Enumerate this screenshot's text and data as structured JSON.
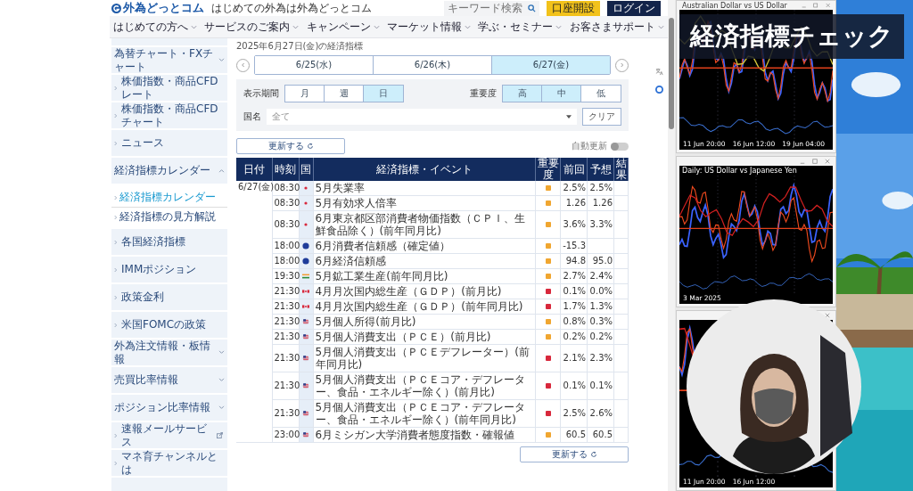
{
  "header": {
    "logo": "外為どっとコム",
    "tagline": "はじめての外為は外為どっとコム",
    "search": {
      "placeholder": "キーワード検索"
    },
    "buttons": [
      {
        "label": "口座開設",
        "kind": "primary"
      },
      {
        "label": "ログイン",
        "kind": "dark"
      }
    ]
  },
  "nav": [
    "はじめての方へ",
    "サービスのご案内",
    "キャンペーン",
    "マーケット情報",
    "学ぶ・セミナー",
    "お客さまサポート"
  ],
  "sidebar": [
    {
      "label": "為替チャート・FXチャート",
      "kind": "group",
      "expanded": false
    },
    {
      "label": "株価指数・商品CFDレート",
      "kind": "link"
    },
    {
      "label": "株価指数・商品CFDチャート",
      "kind": "link"
    },
    {
      "label": "ニュース",
      "kind": "link"
    },
    {
      "label": "経済指標カレンダー",
      "kind": "group",
      "expanded": true,
      "children": [
        {
          "label": "経済指標カレンダー",
          "selected": true
        },
        {
          "label": "経済指標の見方解説",
          "selected": false
        }
      ]
    },
    {
      "label": "各国経済指標",
      "kind": "link"
    },
    {
      "label": "IMMポジション",
      "kind": "link"
    },
    {
      "label": "政策金利",
      "kind": "link"
    },
    {
      "label": "米国FOMCの政策",
      "kind": "link"
    },
    {
      "label": "外為注文情報・板情報",
      "kind": "group",
      "expanded": false
    },
    {
      "label": "売買比率情報",
      "kind": "group",
      "expanded": false
    },
    {
      "label": "ポジション比率情報",
      "kind": "group",
      "expanded": false
    },
    {
      "label": "速報メールサービス",
      "kind": "link",
      "external": true
    },
    {
      "label": "マネ育チャンネルとは",
      "kind": "link"
    }
  ],
  "page_title": "2025年6月27日(金)の経済指標",
  "date_tabs": [
    {
      "label": "6/25(水)",
      "selected": false
    },
    {
      "label": "6/26(木)",
      "selected": false
    },
    {
      "label": "6/27(金)",
      "selected": true
    }
  ],
  "filters": {
    "period": {
      "label": "表示期間",
      "options": [
        {
          "label": "月",
          "selected": false
        },
        {
          "label": "週",
          "selected": false
        },
        {
          "label": "日",
          "selected": true
        }
      ]
    },
    "importance": {
      "label": "重要度",
      "options": [
        {
          "label": "高",
          "selected": true
        },
        {
          "label": "中",
          "selected": true
        },
        {
          "label": "低",
          "selected": false
        }
      ]
    },
    "country": {
      "label": "国名",
      "value": "全て"
    },
    "clear": "クリア"
  },
  "refresh_top": "更新する",
  "refresh_bottom": "更新する",
  "auto_update": {
    "label": "自動更新",
    "on": false
  },
  "table": {
    "columns": [
      "日付",
      "時刻",
      "国",
      "経済指標・イベント",
      "重要度",
      "前回",
      "予想",
      "結果"
    ],
    "date": "6/27(金)",
    "rows": [
      {
        "time": "08:30",
        "kind": "japan",
        "event": "5月失業率",
        "color": "#f0a630",
        "previous": "2.5%",
        "forecast": "2.5%"
      },
      {
        "time": "08:30",
        "kind": "japan",
        "event": "5月有効求人倍率",
        "color": "#f0a630",
        "previous": "1.26",
        "forecast": "1.26"
      },
      {
        "time": "08:30",
        "kind": "japan",
        "event": "6月東京都区部消費者物価指数（ＣＰＩ、生鮮食品除く）(前年同月比)",
        "color": "#f0a630",
        "previous": "3.6%",
        "forecast": "3.3%"
      },
      {
        "time": "18:00",
        "kind": "eu",
        "event": "6月消費者信頼感（確定値）",
        "color": "#f0a630",
        "previous": "-15.3"
      },
      {
        "time": "18:00",
        "kind": "eu",
        "event": "6月経済信頼感",
        "color": "#f0a630",
        "previous": "94.8",
        "forecast": "95.0"
      },
      {
        "time": "19:30",
        "kind": "india",
        "event": "5月鉱工業生産(前年同月比)",
        "color": "#f0a630",
        "previous": "2.7%",
        "forecast": "2.4%"
      },
      {
        "time": "21:30",
        "kind": "canada",
        "event": "4月月次国内総生産（ＧＤＰ）(前月比)",
        "color": "#d8283c",
        "previous": "0.1%",
        "forecast": "0.0%"
      },
      {
        "time": "21:30",
        "kind": "canada",
        "event": "4月月次国内総生産（ＧＤＰ）(前年同月比)",
        "color": "#d8283c",
        "previous": "1.7%",
        "forecast": "1.3%"
      },
      {
        "time": "21:30",
        "kind": "usa",
        "event": "5月個人所得(前月比)",
        "color": "#f0a630",
        "previous": "0.8%",
        "forecast": "0.3%"
      },
      {
        "time": "21:30",
        "kind": "usa",
        "event": "5月個人消費支出（ＰＣＥ）(前月比)",
        "color": "#f0a630",
        "previous": "0.2%",
        "forecast": "0.2%"
      },
      {
        "time": "21:30",
        "kind": "usa",
        "event": "5月個人消費支出（ＰＣＥデフレーター）(前年同月比)",
        "color": "#d8283c",
        "previous": "2.1%",
        "forecast": "2.3%"
      },
      {
        "time": "21:30",
        "kind": "usa",
        "event": "5月個人消費支出（ＰＣＥコア・デフレーター、食品・エネルギー除く）(前月比)",
        "color": "#d8283c",
        "previous": "0.1%",
        "forecast": "0.1%"
      },
      {
        "time": "21:30",
        "kind": "usa",
        "event": "5月個人消費支出（ＰＣＥコア・デフレーター、食品・エネルギー除く）(前年同月比)",
        "color": "#d8283c",
        "previous": "2.5%",
        "forecast": "2.6%"
      },
      {
        "time": "23:00",
        "kind": "usa",
        "event": "6月ミシガン大学消費者態度指数・確報値",
        "color": "#f0a630",
        "previous": "60.5",
        "forecast": "60.5"
      }
    ]
  },
  "chart_windows": [
    {
      "window_title": "Australian Dollar vs US Dollar",
      "x_labels": [
        "11 Jun 20:00",
        "16 Jun 12:00",
        "19 Jun 04:00"
      ]
    },
    {
      "title": "Daily: US Dollar vs Japanese Yen",
      "x_labels": [
        "3 Mar 2025"
      ]
    },
    {
      "x_labels": [
        "11 Jun 20:00",
        "16 Jun 12:00"
      ]
    }
  ],
  "caption": "経済指標チェック"
}
